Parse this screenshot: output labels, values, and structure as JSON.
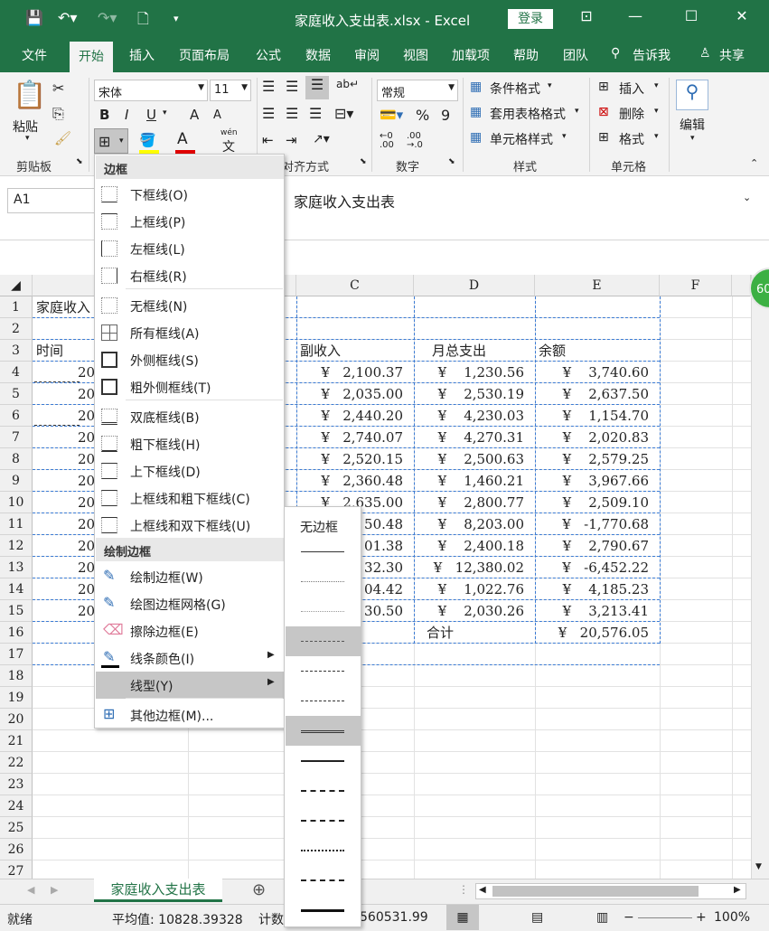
{
  "titlebar": {
    "title": "家庭收入支出表.xlsx  -  Excel",
    "login": "登录",
    "accent": "#217346"
  },
  "tabs": [
    "文件",
    "开始",
    "插入",
    "页面布局",
    "公式",
    "数据",
    "审阅",
    "视图",
    "加载项",
    "帮助",
    "团队"
  ],
  "tabs_right": {
    "tell_me": "告诉我",
    "share": "共享"
  },
  "ribbon": {
    "paste": "粘贴",
    "font_name": "宋体",
    "font_size": "11",
    "number_format": "常规",
    "percent": "%",
    "comma": "9",
    "cond_format": "条件格式",
    "table_format": "套用表格格式",
    "cell_style": "单元格样式",
    "insert": "插入",
    "delete": "删除",
    "format": "格式",
    "edit": "编辑",
    "bold": "B",
    "italic": "I",
    "underline": "U",
    "grow": "A",
    "shrink": "A",
    "phonetic": "wén",
    "phonetic_char": "文",
    "groups": {
      "clipboard": "剪贴板",
      "alignment": "对齐方式",
      "number": "数字",
      "styles": "样式",
      "cells": "单元格"
    }
  },
  "formula_bar": {
    "name_box": "A1",
    "content": "家庭收入支出表"
  },
  "columns": [
    "C",
    "D",
    "E",
    "F"
  ],
  "rows": [
    "1",
    "2",
    "3",
    "4",
    "5",
    "6",
    "7",
    "8",
    "9",
    "10",
    "11",
    "12",
    "13",
    "14",
    "15",
    "16",
    "17",
    "18",
    "19",
    "20",
    "21",
    "22",
    "23",
    "24",
    "25",
    "26",
    "27"
  ],
  "cells": {
    "a1": "家庭收入",
    "a3": "时间",
    "c3": "副收入",
    "d3": "月总支出",
    "e3": "余额",
    "a_partial": [
      "20",
      "20",
      "20",
      "20",
      "20",
      "20",
      "20",
      "20",
      "20",
      "20",
      "20",
      "20"
    ],
    "c": [
      "¥   2,100.37",
      "¥   2,035.00",
      "¥   2,440.20",
      "¥   2,740.07",
      "¥   2,520.15",
      "¥   2,360.48",
      "¥   2,635.00",
      "50.48",
      "01.38",
      "32.30",
      "04.42",
      "30.50"
    ],
    "d": [
      "¥    1,230.56",
      "¥    2,530.19",
      "¥    4,230.03",
      "¥    4,270.31",
      "¥    2,500.63",
      "¥    1,460.21",
      "¥    2,800.77",
      "¥    8,203.00",
      "¥    2,400.18",
      "¥   12,380.02",
      "¥    1,022.76",
      "¥    2,030.26"
    ],
    "e": [
      "¥    3,740.60",
      "¥    2,637.50",
      "¥    1,154.70",
      "¥    2,020.83",
      "¥    2,579.25",
      "¥    3,967.66",
      "¥    2,509.10",
      "¥   -1,770.68",
      "¥    2,790.67",
      "¥   -6,452.22",
      "¥    4,185.23",
      "¥    3,213.41"
    ],
    "d16": "合计",
    "e16": "¥   20,576.05"
  },
  "border_menu": {
    "header1": "边框",
    "items1": [
      "下框线(O)",
      "上框线(P)",
      "左框线(L)",
      "右框线(R)",
      "无框线(N)",
      "所有框线(A)",
      "外侧框线(S)",
      "粗外侧框线(T)",
      "双底框线(B)",
      "粗下框线(H)",
      "上下框线(D)",
      "上框线和粗下框线(C)",
      "上框线和双下框线(U)"
    ],
    "header2": "绘制边框",
    "items2": [
      "绘制边框(W)",
      "绘图边框网格(G)",
      "擦除边框(E)",
      "线条颜色(I)",
      "线型(Y)",
      "其他边框(M)..."
    ]
  },
  "line_menu": {
    "no_border": "无边框"
  },
  "sheet_tab": "家庭收入支出表",
  "status": {
    "ready": "就绪",
    "average": "平均值: 10828.39328",
    "count": "计数",
    "sum": "560531.99",
    "zoom": "100%"
  },
  "badge": "60"
}
